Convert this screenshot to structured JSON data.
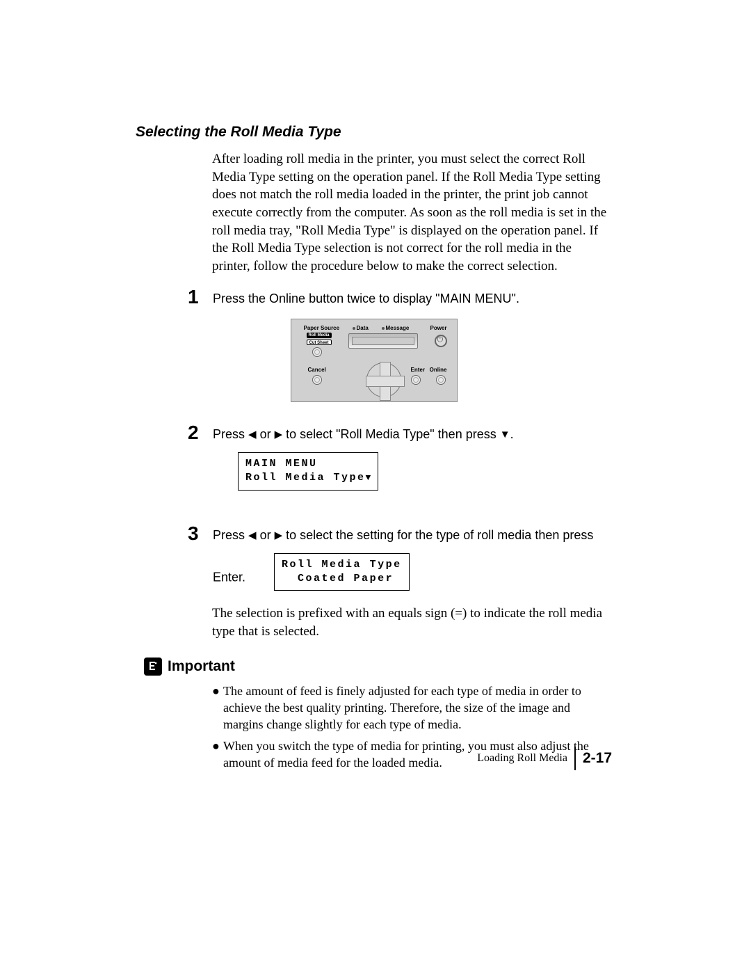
{
  "section_title": "Selecting the Roll Media Type",
  "intro": "After loading roll media in the printer, you must select the correct Roll Media Type setting on the operation panel. If the Roll Media Type setting does not match the roll media loaded in the printer, the print job cannot execute correctly from the computer. As soon as the roll media is set in the roll media tray, \"Roll Media Type\" is displayed on the operation panel. If the Roll Media Type selection is not correct for the roll media in the printer, follow the procedure below to make the correct selection.",
  "steps": {
    "s1": {
      "num": "1",
      "text": "Press the Online button twice to display \"MAIN MENU\"."
    },
    "s2": {
      "num": "2",
      "text_before": "Press ",
      "text_mid": " or ",
      "text_after": " to select \"Roll Media Type\" then press ",
      "text_end": "."
    },
    "s3": {
      "num": "3",
      "text_before": "Press ",
      "text_mid": " or ",
      "text_after": " to select the setting for the type of roll media then press Enter."
    }
  },
  "lcd1_line1": "MAIN MENU",
  "lcd1_line2": "Roll Media Type",
  "lcd2_line1": "Roll Media Type",
  "lcd2_line2": "  Coated Paper",
  "note": "The selection is prefixed with an equals sign (=) to indicate the roll media type that is selected.",
  "important_label": "Important",
  "bullets": {
    "b1": "The amount of feed is finely adjusted for each type of media in order to achieve the best quality printing. Therefore, the size of the image and margins change slightly for each type of media.",
    "b2": "When you switch the type of media for printing, you must also adjust the amount of media feed for the loaded media."
  },
  "panel": {
    "paper_source": "Paper Source",
    "roll_media": "Roll Media",
    "cut_sheet": "Cut Sheet",
    "data": "Data",
    "message": "Message",
    "power": "Power",
    "cancel": "Cancel",
    "enter": "Enter",
    "online": "Online"
  },
  "footer": {
    "title": "Loading Roll Media",
    "page": "2-17"
  },
  "glyphs": {
    "left": "◀",
    "right": "▶",
    "down": "▼",
    "bullet": "●"
  }
}
